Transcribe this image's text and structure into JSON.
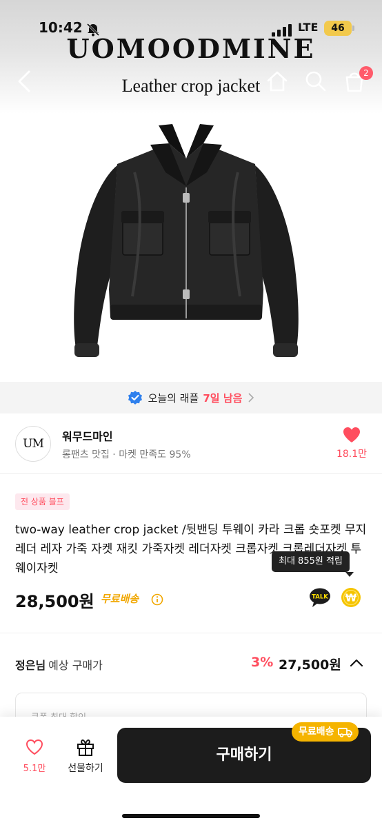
{
  "status_bar": {
    "time": "10:42",
    "network": "LTE",
    "battery": "46"
  },
  "hero": {
    "brand": "UOMOODMINE",
    "caption": "Leather crop jacket",
    "cart_count": "2"
  },
  "raffle": {
    "text": "오늘의 래플",
    "remaining": "7일 남음"
  },
  "shop": {
    "logo_text": "UM",
    "name": "워무드마인",
    "description": "롱팬츠 맛집 · 마켓 만족도 95%",
    "likes": "18.1만"
  },
  "product": {
    "tag": "전 상품 블프",
    "title": "two-way leather crop jacket /뒷밴딩 투웨이 카라 크롭 숏포켓 무지 레더 레자 가죽 자켓 재킷 가죽자켓 레더자켓 크롭자켓 크롭레더자켓 투웨이자켓",
    "price": "28,500원",
    "shipping": "무료배송",
    "points_tooltip": "최대 855원 적립",
    "talk_label": "TALK",
    "won_symbol": "₩"
  },
  "member_price": {
    "name": "정은님",
    "label": "예상 구매가",
    "discount": "3%",
    "price": "27,500원"
  },
  "coupon": {
    "title": "쿠폰 최대 할인"
  },
  "bottom_bar": {
    "like_count": "5.1만",
    "gift_label": "선물하기",
    "buy_label": "구매하기",
    "free_shipping": "무료배송"
  },
  "colors": {
    "accent": "#ff4d5e",
    "shipping": "#f1a700",
    "buy_button": "#1c1c1c",
    "badge": "#f5b400"
  }
}
